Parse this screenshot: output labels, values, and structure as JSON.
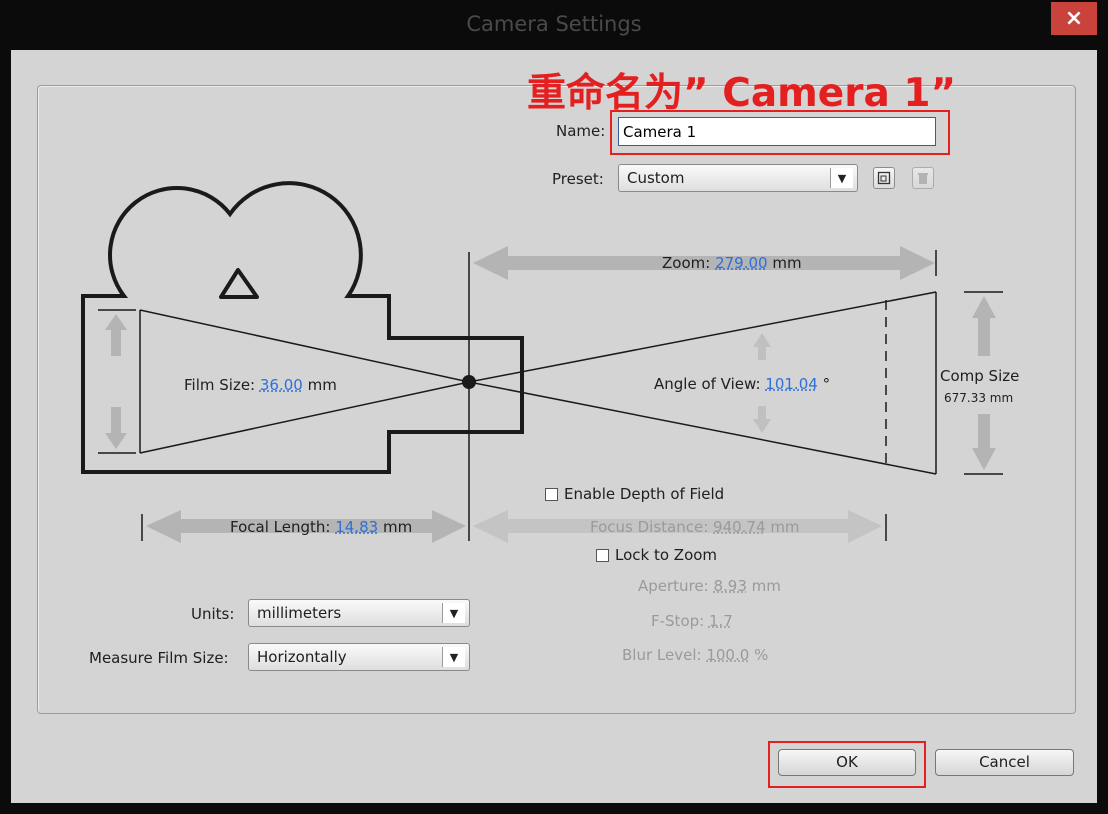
{
  "window": {
    "title": "Camera Settings",
    "close_label": "×"
  },
  "annotation": {
    "text": "重命名为” Camera 1”"
  },
  "name": {
    "label": "Name:",
    "value": "Camera 1"
  },
  "preset": {
    "label": "Preset:",
    "value": "Custom"
  },
  "zoom": {
    "label": "Zoom:",
    "value": "279.00",
    "unit": "mm"
  },
  "film_size": {
    "label": "Film Size:",
    "value": "36.00",
    "unit": "mm"
  },
  "angle_of_view": {
    "label": "Angle of View:",
    "value": "101.04",
    "unit": "°"
  },
  "comp_size": {
    "label": "Comp Size",
    "value": "677.33 mm"
  },
  "focal_length": {
    "label": "Focal Length:",
    "value": "14.83",
    "unit": "mm"
  },
  "depth_of_field": {
    "enable_label": "Enable Depth of Field",
    "enabled": false
  },
  "focus_distance": {
    "label": "Focus Distance:",
    "value": "940.74",
    "unit": "mm"
  },
  "lock_to_zoom": {
    "label": "Lock to Zoom",
    "checked": false
  },
  "aperture": {
    "label": "Aperture:",
    "value": "8.93",
    "unit": "mm"
  },
  "fstop": {
    "label": "F-Stop:",
    "value": "1.7"
  },
  "blur_level": {
    "label": "Blur Level:",
    "value": "100.0",
    "unit": "%"
  },
  "units": {
    "label": "Units:",
    "value": "millimeters"
  },
  "measure_film_size": {
    "label": "Measure Film Size:",
    "value": "Horizontally"
  },
  "buttons": {
    "ok": "OK",
    "cancel": "Cancel"
  },
  "colors": {
    "accent_value": "#2f6fd6",
    "annotation_red": "#e41f1f",
    "dialog_bg": "#d4d4d4",
    "titlebar_bg": "#0b0b0b",
    "close_red": "#c9423b"
  }
}
